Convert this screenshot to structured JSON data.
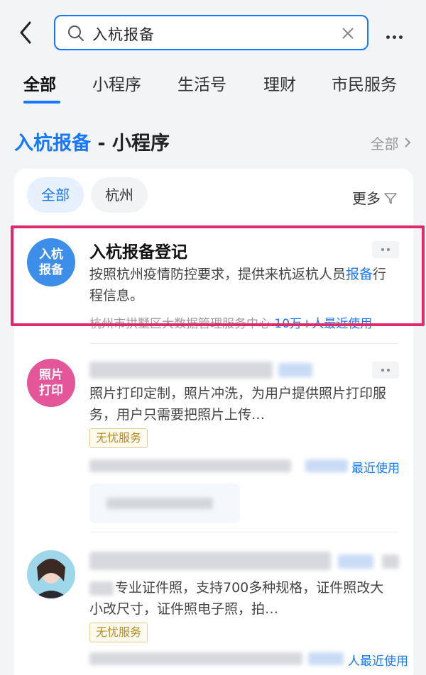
{
  "header": {
    "search_value": "入杭报备",
    "tabs": [
      "全部",
      "小程序",
      "生活号",
      "理财",
      "市民服务"
    ]
  },
  "section": {
    "title_keyword": "入杭报备",
    "title_suffix": " - 小程序",
    "all_link": "全部"
  },
  "card": {
    "chips": [
      "全部",
      "杭州"
    ],
    "filter_label": "更多"
  },
  "results": [
    {
      "avatar_text": "入杭\n报备",
      "title": "入杭报备登记",
      "desc_before": "按照杭州疫情防控要求，提供来杭返杭人员",
      "desc_keyword": "报备",
      "desc_after": "行程信息。",
      "meta_org": "杭州市拱墅区大数据管理服务中心",
      "meta_usage": "10万+人最近使用"
    },
    {
      "avatar_text": "照片\n打印",
      "desc": "照片打印定制，照片冲洗，为用户提供照片打印服务，用户只需要把照片上传…",
      "badge": "无忧服务",
      "meta_usage": "最近使用"
    },
    {
      "desc": "专业证件照，支持700多种规格，证件照改大小改尺寸，证件照电子照，拍…",
      "badge": "无忧服务",
      "meta_usage": "人最近使用"
    }
  ],
  "colors": {
    "accent": "#1677ff",
    "highlight": "#e0296b",
    "avatar_blue": "#3d8ee8",
    "avatar_pink": "#e5559a"
  }
}
